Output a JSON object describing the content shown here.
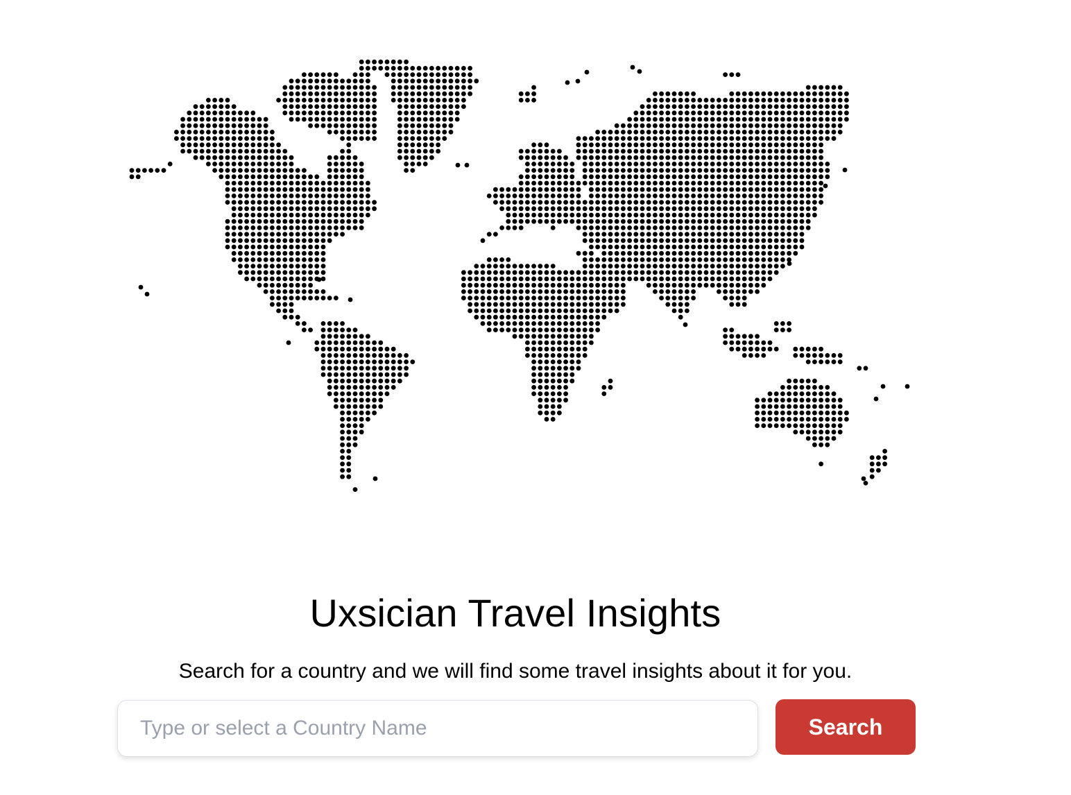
{
  "map": {
    "icon": "world-dot-map",
    "dot_color": "#000000"
  },
  "header": {
    "title": "Uxsician Travel Insights",
    "subtitle": "Search for a country and we will find some travel insights about it for you."
  },
  "search": {
    "placeholder": "Type or select a Country Name",
    "value": "",
    "button_label": "Search",
    "button_color": "#c93a32"
  }
}
